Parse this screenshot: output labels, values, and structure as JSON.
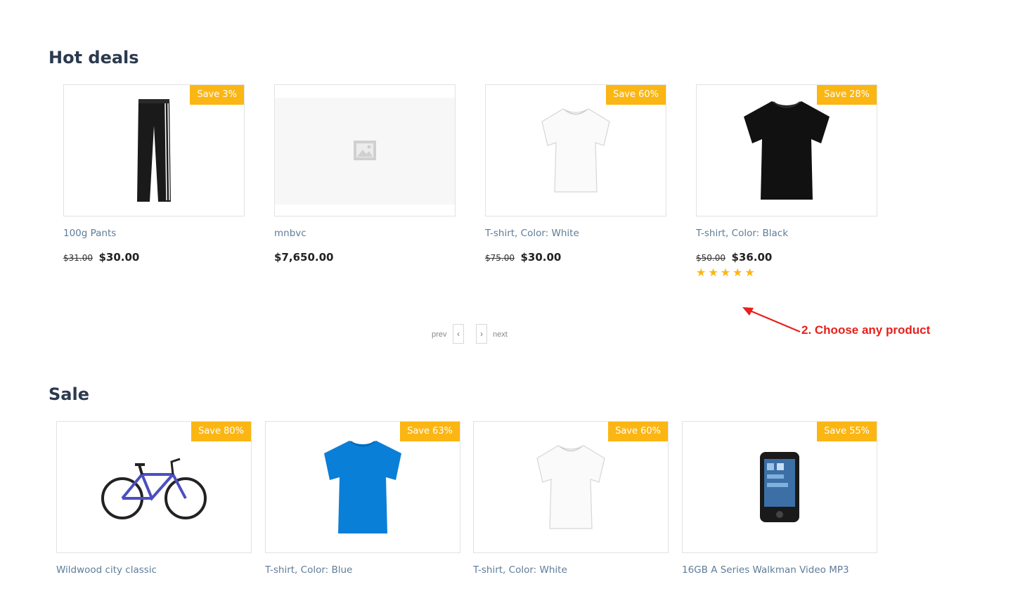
{
  "hot_deals": {
    "title": "Hot deals",
    "products": [
      {
        "name": "100g Pants",
        "old_price": "$31.00",
        "price": "$30.00",
        "badge": "Save 3%",
        "image": "track-pants-icon"
      },
      {
        "name": "mnbvc",
        "old_price": "",
        "price": "$7,650.00",
        "badge": "",
        "image": "image-placeholder-icon"
      },
      {
        "name": "T-shirt, Color: White",
        "old_price": "$75.00",
        "price": "$30.00",
        "badge": "Save 60%",
        "image": "white-tshirt-icon"
      },
      {
        "name": "T-shirt, Color: Black",
        "old_price": "$50.00",
        "price": "$36.00",
        "badge": "Save 28%",
        "image": "black-tshirt-icon",
        "rating": 5
      }
    ]
  },
  "pagination": {
    "prev_label": "prev",
    "next_label": "next"
  },
  "annotation": {
    "text": "2. Choose any product",
    "color": "#e8201c"
  },
  "sale": {
    "title": "Sale",
    "products": [
      {
        "name": "Wildwood city classic",
        "badge": "Save 80%",
        "image": "bicycle-icon"
      },
      {
        "name": "T-shirt, Color: Blue",
        "badge": "Save 63%",
        "image": "blue-tshirt-icon"
      },
      {
        "name": "T-shirt, Color: White",
        "badge": "Save 60%",
        "image": "white-tshirt-icon"
      },
      {
        "name": "16GB A Series Walkman Video MP3",
        "badge": "Save 55%",
        "image": "walkman-player-icon"
      }
    ]
  },
  "colors": {
    "badge": "#fbb614",
    "title": "#2c3a4e",
    "link": "#5f7c99",
    "stars": "#fbb614"
  }
}
